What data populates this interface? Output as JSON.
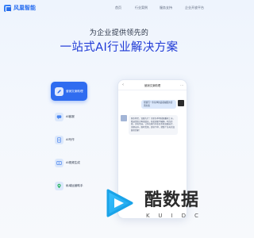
{
  "brand": {
    "name": "风巢智能"
  },
  "nav": [
    {
      "label": "首页"
    },
    {
      "label": "行业案例"
    },
    {
      "label": "服务支持"
    },
    {
      "label": "企业开放平台"
    }
  ],
  "hero": {
    "subtitle": "为企业提供领先的",
    "title": "一站式AI行业解决方案"
  },
  "features": [
    {
      "label": "营销文案助理",
      "icon": "pen-icon",
      "active": true
    },
    {
      "label": "AI客服",
      "icon": "chat-icon",
      "active": false
    },
    {
      "label": "AI写作",
      "icon": "document-icon",
      "active": false
    },
    {
      "label": "AI视频生成",
      "icon": "video-icon",
      "active": false
    },
    {
      "label": "私域运营助手",
      "icon": "location-icon",
      "active": false
    }
  ],
  "phone": {
    "title": "营销文案助理",
    "user_message": "帮我写一条冬季新品羽绒服的营销文案",
    "ai_message": "寒冬将至，温暖先行！全新冬季羽绒服重磅上市，精选优质白鸭绒填充，轻盈保暖不臃肿。时尚剪裁，多色可选，让你在寒冷的冬日也能温暖出行、美丽出众。限时优惠，即刻下单，把整个冬天的温暖带回家！"
  },
  "watermark": {
    "text": "酷数据",
    "sub": "KUIDC"
  },
  "colors": {
    "accent": "#2f6cf0",
    "title_blue": "#1f3ad6"
  }
}
